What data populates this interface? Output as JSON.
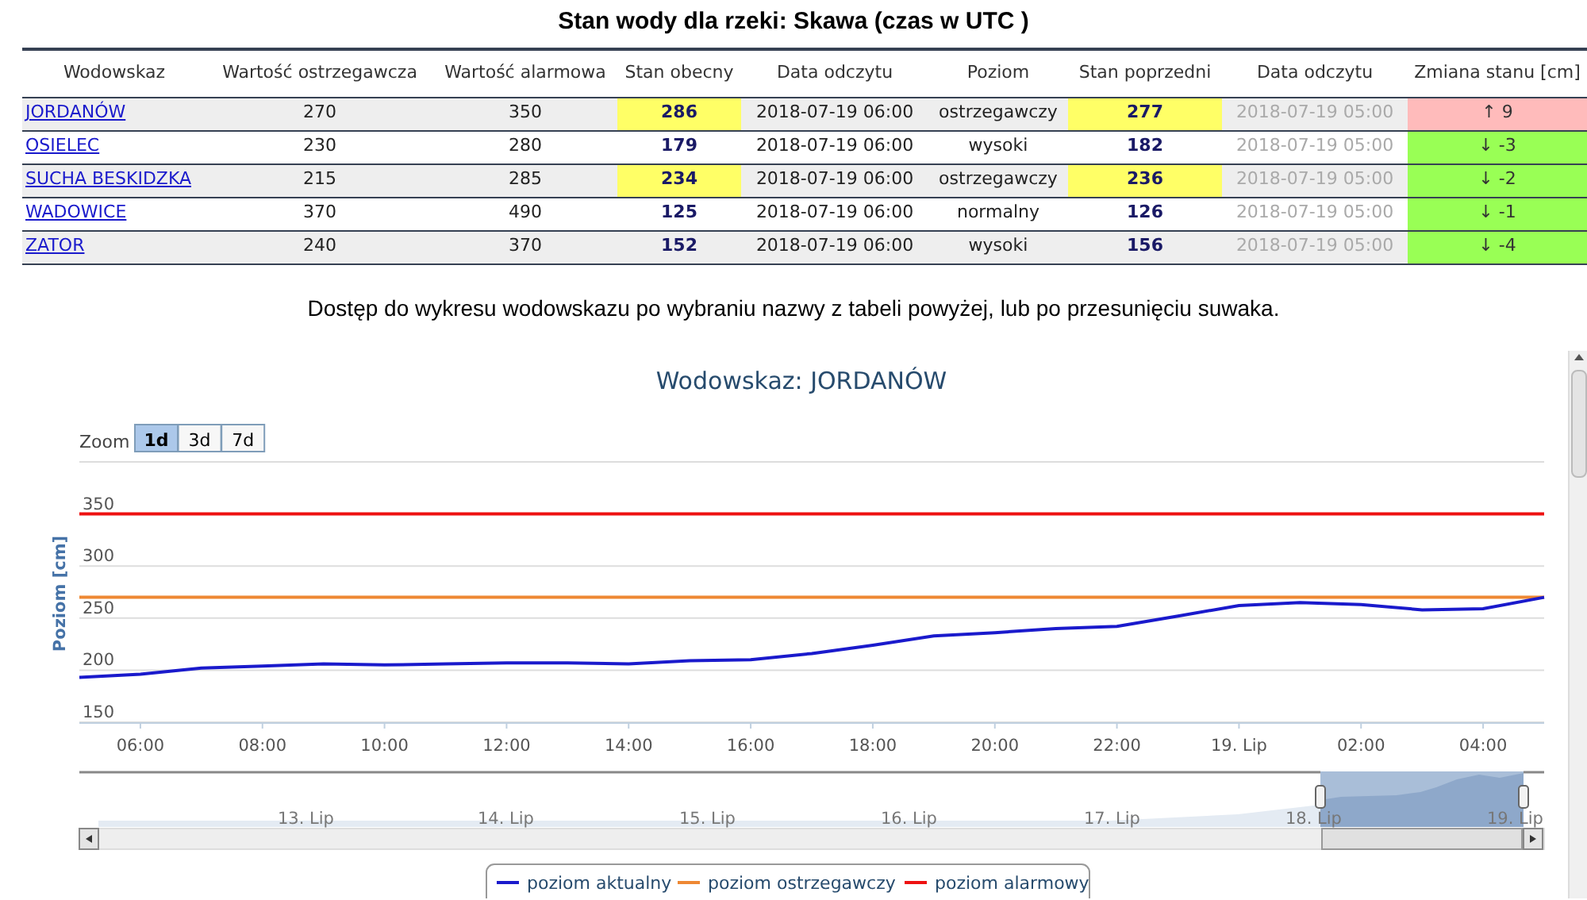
{
  "title": "Stan wody dla rzeki: Skawa (czas w UTC )",
  "table": {
    "columns": [
      "Wodowskaz",
      "Wartość ostrzegawcza",
      "Wartość alarmowa",
      "Stan obecny",
      "Data odczytu",
      "Poziom",
      "Stan poprzedni",
      "Data odczytu",
      "Zmiana stanu [cm]"
    ],
    "rows": [
      {
        "station": "JORDANÓW",
        "warning": "270",
        "alarm": "350",
        "current": "286",
        "current_highlighted": true,
        "date": "2018-07-19 06:00",
        "level_name": "ostrzegawczy",
        "previous": "277",
        "previous_highlighted": true,
        "previous_date": "2018-07-19 05:00",
        "change": "↑ 9",
        "rising": true
      },
      {
        "station": "OSIELEC",
        "warning": "230",
        "alarm": "280",
        "current": "179",
        "current_highlighted": false,
        "date": "2018-07-19 06:00",
        "level_name": "wysoki",
        "previous": "182",
        "previous_highlighted": false,
        "previous_date": "2018-07-19 05:00",
        "change": "↓ -3",
        "rising": false
      },
      {
        "station": "SUCHA BESKIDZKA",
        "warning": "215",
        "alarm": "285",
        "current": "234",
        "current_highlighted": true,
        "date": "2018-07-19 06:00",
        "level_name": "ostrzegawczy",
        "previous": "236",
        "previous_highlighted": true,
        "previous_date": "2018-07-19 05:00",
        "change": "↓ -2",
        "rising": false
      },
      {
        "station": "WADOWICE",
        "warning": "370",
        "alarm": "490",
        "current": "125",
        "current_highlighted": false,
        "date": "2018-07-19 06:00",
        "level_name": "normalny",
        "previous": "126",
        "previous_highlighted": false,
        "previous_date": "2018-07-19 05:00",
        "change": "↓ -1",
        "rising": false
      },
      {
        "station": "ZATOR",
        "warning": "240",
        "alarm": "370",
        "current": "152",
        "current_highlighted": false,
        "date": "2018-07-19 06:00",
        "level_name": "wysoki",
        "previous": "156",
        "previous_highlighted": false,
        "previous_date": "2018-07-19 05:00",
        "change": "↓ -4",
        "rising": false
      }
    ]
  },
  "hint": "Dostęp do wykresu wodowskazu po wybraniu nazwy z tabeli powyżej, lub po przesunięciu suwaka.",
  "chart": {
    "zoom_label": "Zoom",
    "zoom_buttons": [
      {
        "label": "1d",
        "selected": true
      },
      {
        "label": "3d",
        "selected": false
      },
      {
        "label": "7d",
        "selected": false
      }
    ],
    "chart_data": {
      "type": "line",
      "title": "Wodowskaz: JORDANÓW",
      "ylabel": "Poziom [cm]",
      "categories": [
        null,
        "06:00",
        null,
        "08:00",
        null,
        "10:00",
        null,
        "12:00",
        null,
        "14:00",
        null,
        "16:00",
        null,
        "18:00",
        null,
        "20:00",
        null,
        "22:00",
        null,
        "19. Lip",
        null,
        "02:00",
        null,
        "04:00",
        null
      ],
      "series": [
        {
          "name": "poziom aktualny",
          "color": "#1a1acc",
          "values": [
            193,
            196,
            202,
            204,
            206,
            205,
            206,
            207,
            207,
            206,
            209,
            210,
            216,
            224,
            233,
            236,
            240,
            242,
            252,
            262,
            265,
            263,
            258,
            259,
            270
          ]
        },
        {
          "name": "poziom ostrzegawczy",
          "color": "#ee8833",
          "values": [
            270,
            270,
            270,
            270,
            270,
            270,
            270,
            270,
            270,
            270,
            270,
            270,
            270,
            270,
            270,
            270,
            270,
            270,
            270,
            270,
            270,
            270,
            270,
            270,
            270
          ]
        },
        {
          "name": "poziom alarmowy",
          "color": "#ee1111",
          "values": [
            350,
            350,
            350,
            350,
            350,
            350,
            350,
            350,
            350,
            350,
            350,
            350,
            350,
            350,
            350,
            350,
            350,
            350,
            350,
            350,
            350,
            350,
            350,
            350,
            350
          ]
        }
      ],
      "ylim": [
        150,
        400
      ],
      "grid": true,
      "legend": true,
      "yticks": [
        150,
        200,
        250,
        300,
        350
      ]
    },
    "navigator_labels": [
      "13. Lip",
      "14. Lip",
      "15. Lip",
      "16. Lip",
      "17. Lip",
      "18. Lip",
      "19. Lip"
    ]
  }
}
